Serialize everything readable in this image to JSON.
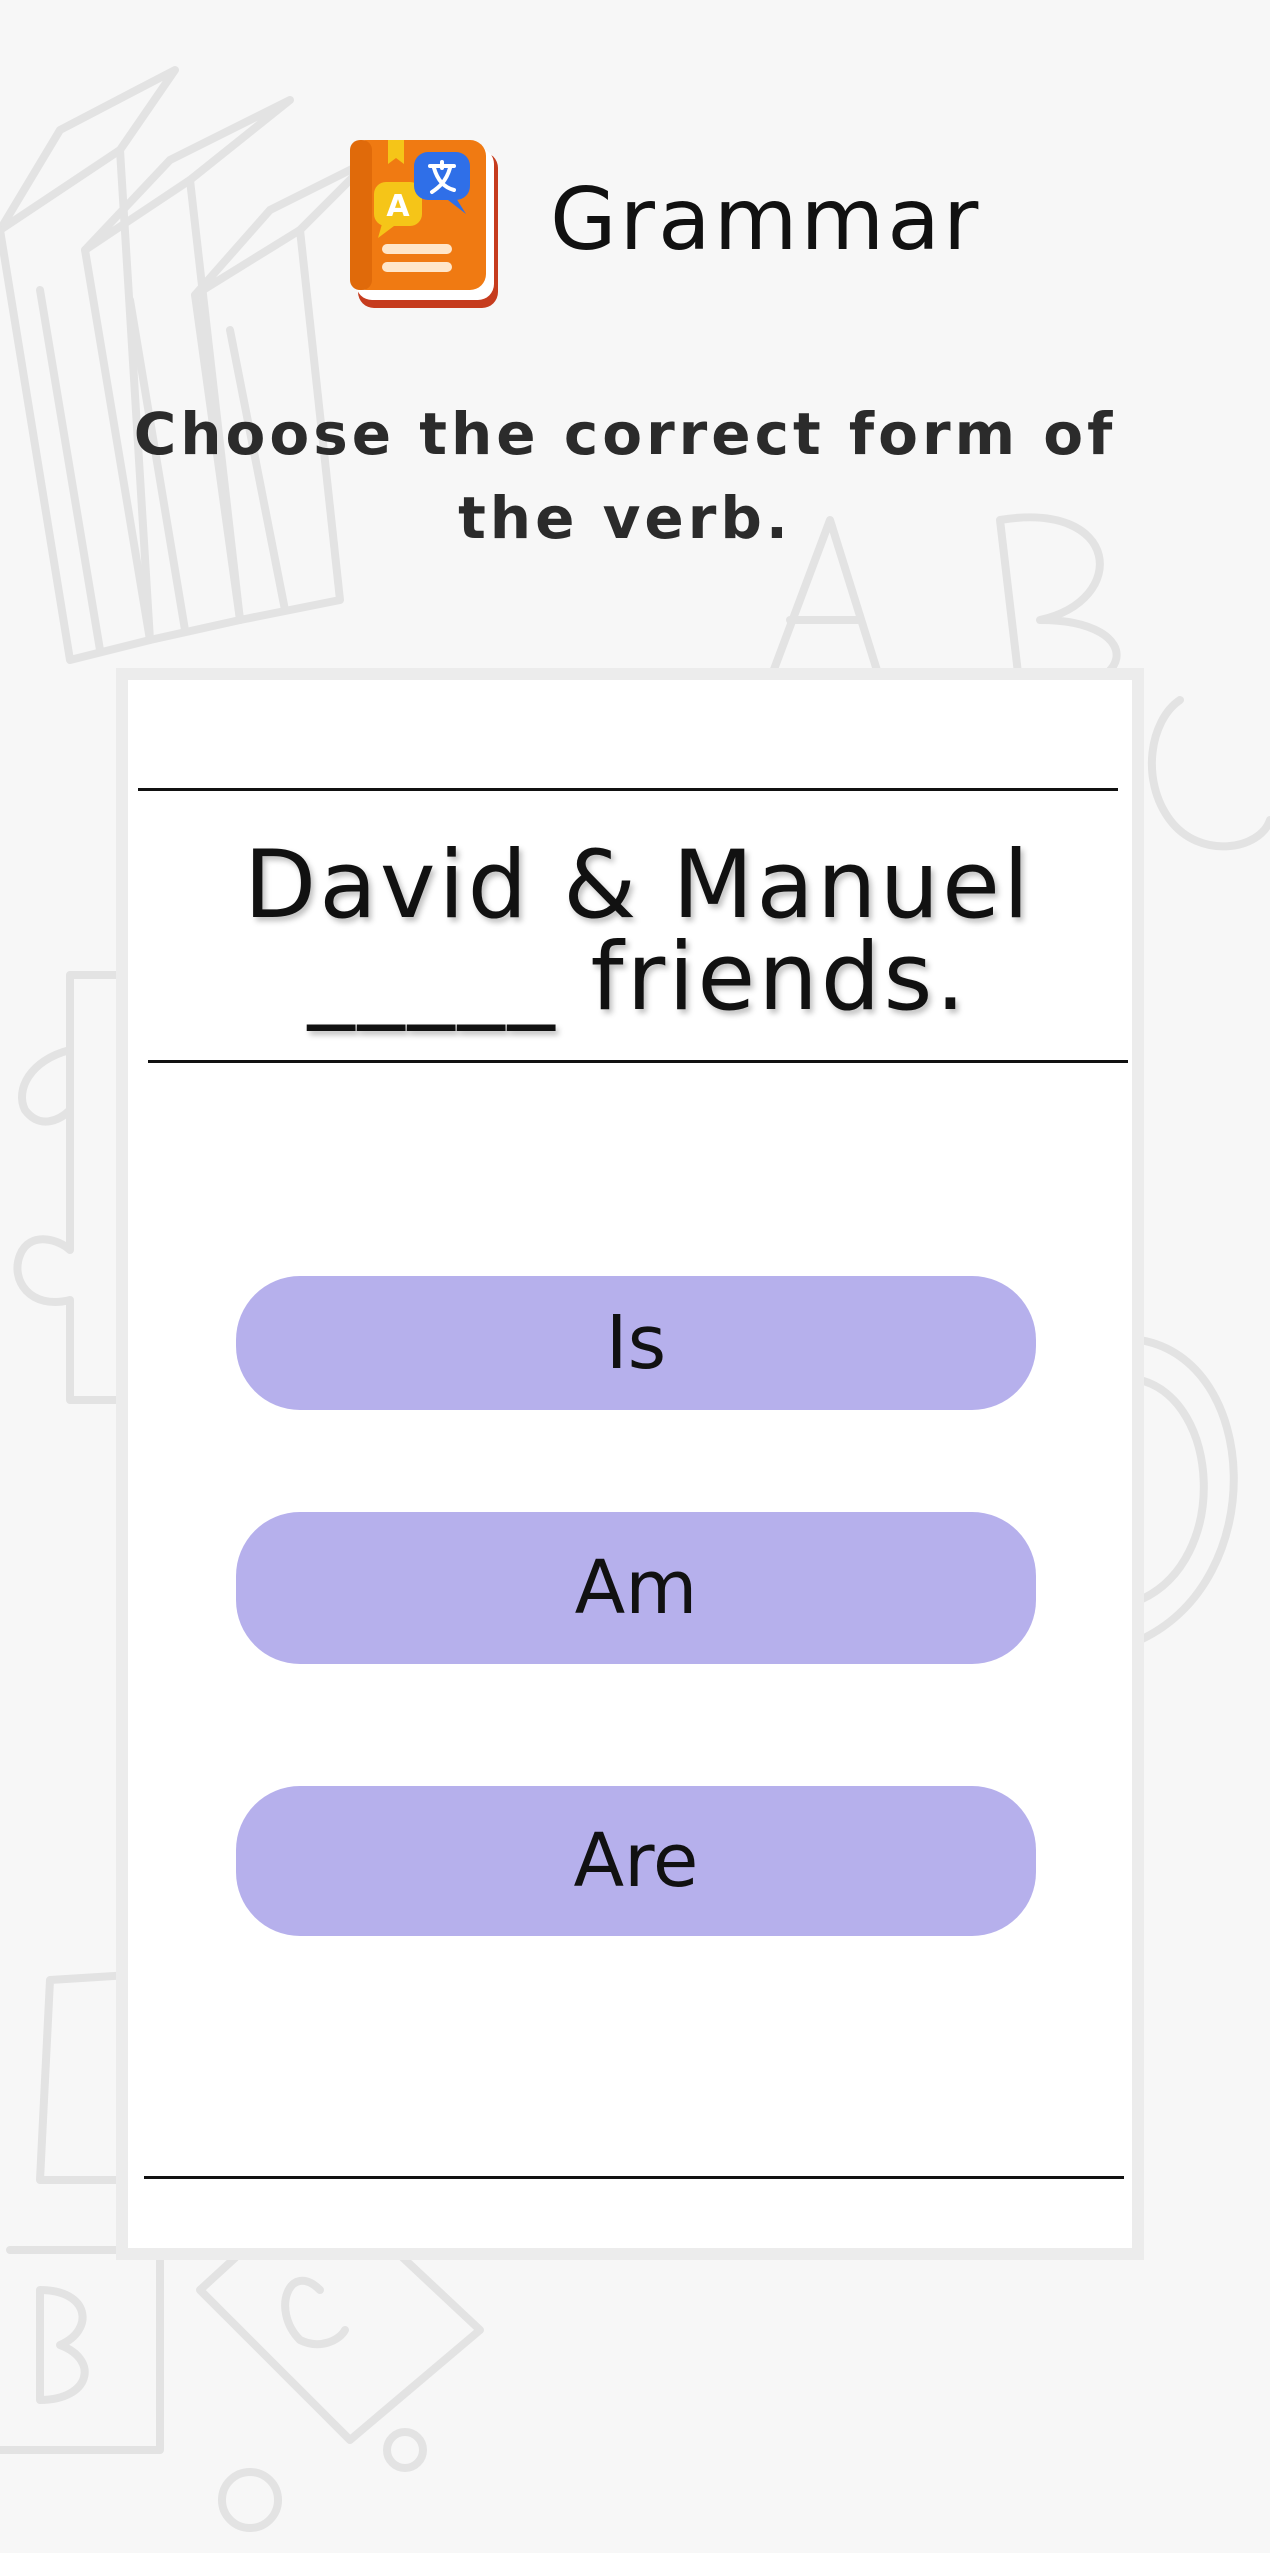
{
  "header": {
    "title": "Grammar",
    "icon": "grammar-book-icon"
  },
  "instruction": "Choose the correct form of the verb.",
  "question": {
    "text": "David & Manuel _____ friends."
  },
  "options": [
    {
      "label": "Is"
    },
    {
      "label": "Am"
    },
    {
      "label": "Are"
    }
  ],
  "colors": {
    "background": "#f7f7f7",
    "card": "#ffffff",
    "option_fill": "#b6b0ec",
    "icon_book": "#f07a12",
    "icon_bubble_yellow": "#f5c518",
    "icon_bubble_blue": "#2f6fe8"
  }
}
